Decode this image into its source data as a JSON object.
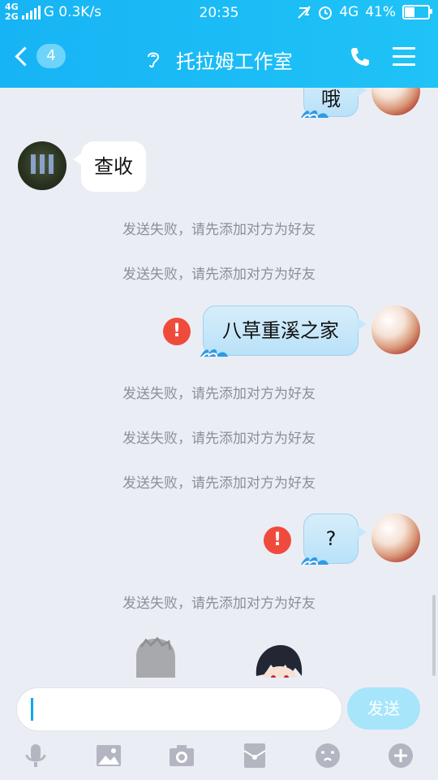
{
  "status_bar": {
    "network_top": "4G",
    "network_bottom": "2G",
    "speed": "G 0.3K/s",
    "time": "20:35",
    "network_right": "4G",
    "battery_percent": "41%",
    "battery_level": 0.41
  },
  "header": {
    "unread_count": "4",
    "title": "托拉姆工作室"
  },
  "messages": {
    "top_partial": "哦",
    "incoming_1": "查收",
    "system_1": "发送失败，请先添加对方为好友",
    "system_2": "发送失败，请先添加对方为好友",
    "outgoing_1": "八草重溪之家",
    "system_3": "发送失败，请先添加对方为好友",
    "system_4": "发送失败，请先添加对方为好友",
    "system_5": "发送失败，请先添加对方为好友",
    "outgoing_2": "?",
    "system_6": "发送失败，请先添加对方为好友",
    "error_mark": "!"
  },
  "input": {
    "value": "",
    "send_label": "发送"
  },
  "toolbar": {
    "icons": [
      "microphone-icon",
      "image-icon",
      "camera-icon",
      "red-packet-icon",
      "emoji-icon",
      "plus-icon"
    ]
  },
  "colors": {
    "header_blue": "#17b4f5",
    "error_red": "#ef4b3c",
    "send_disabled": "#a7e5fb"
  }
}
